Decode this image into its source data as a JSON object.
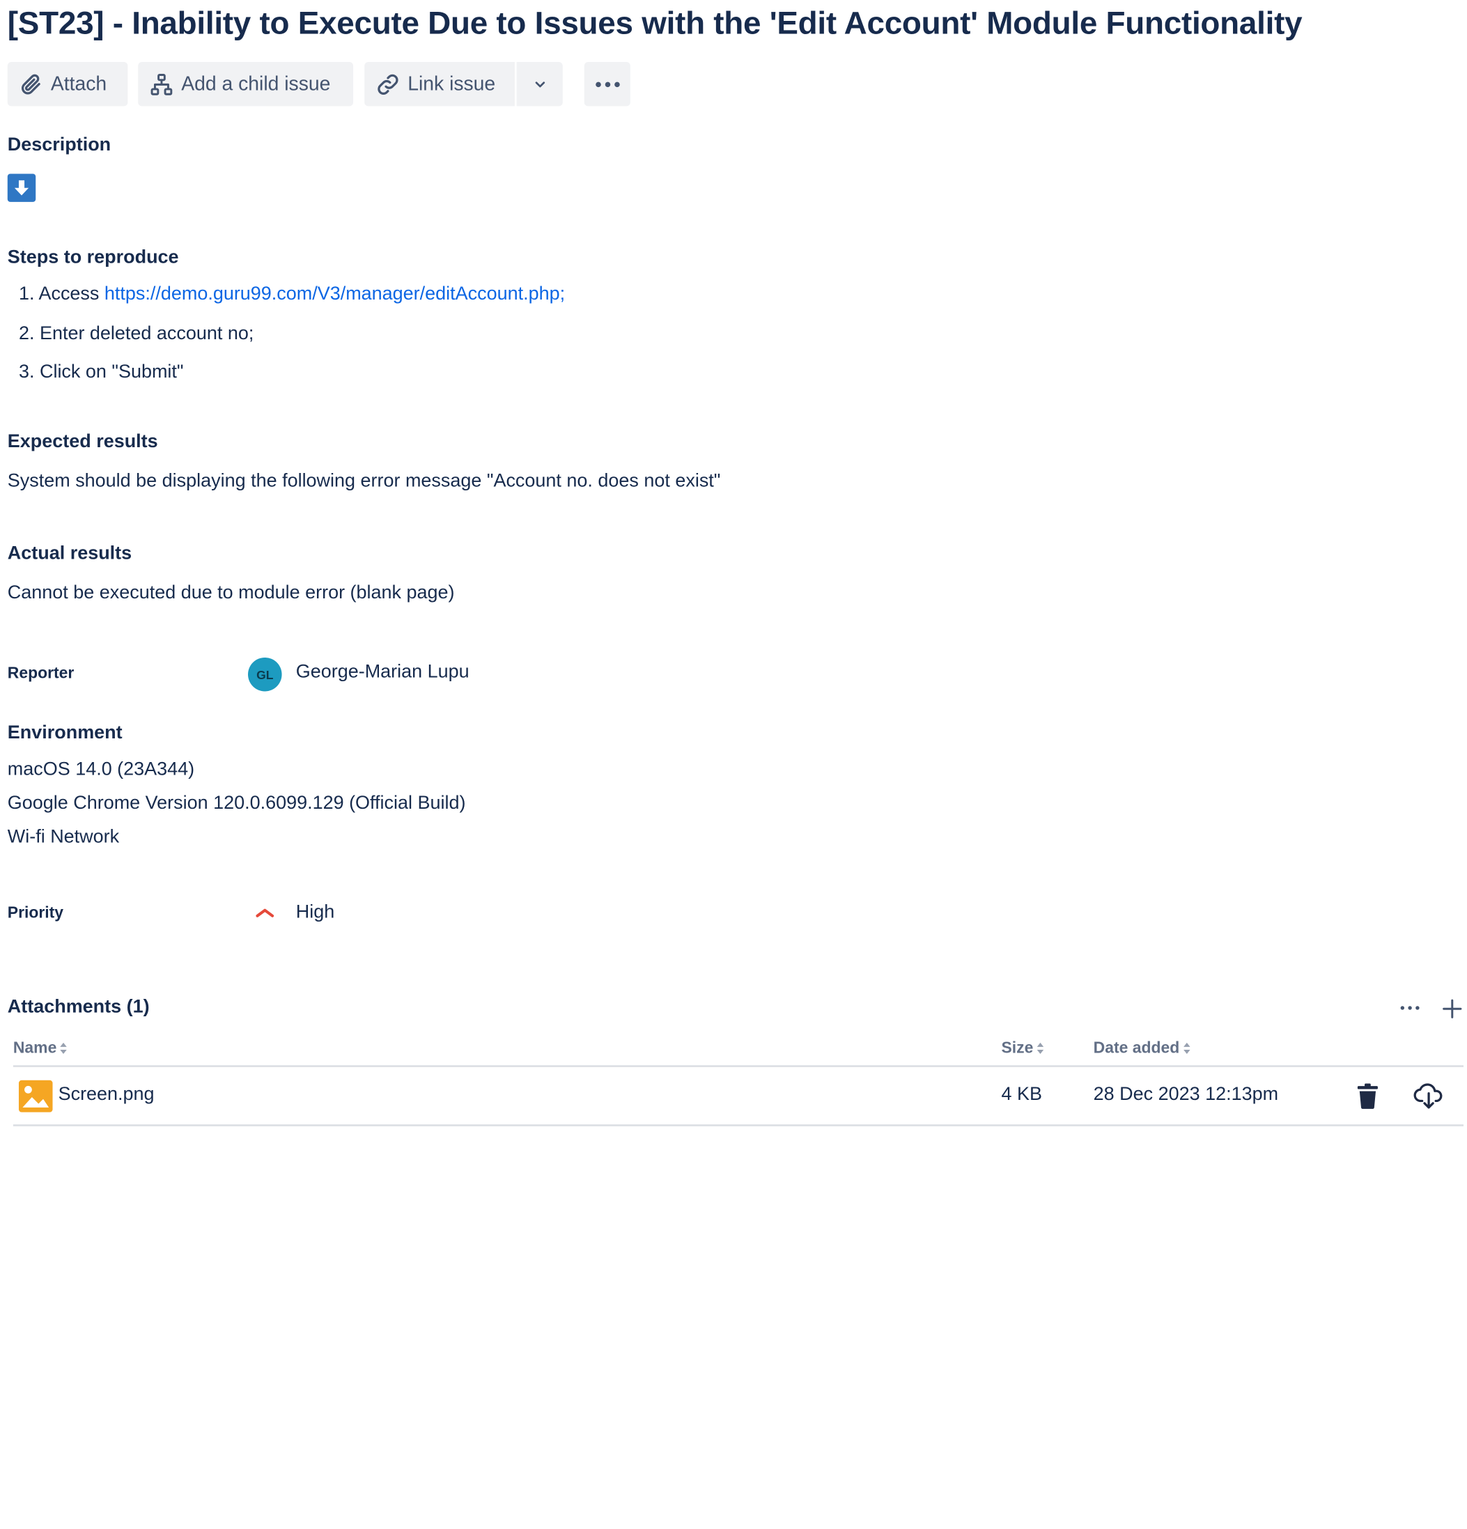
{
  "issue": {
    "title": "[ST23] - Inability to Execute Due to Issues with the 'Edit Account' Module Functionality"
  },
  "toolbar": {
    "attach_label": "Attach",
    "add_child_label": "Add a child issue",
    "link_issue_label": "Link issue"
  },
  "description": {
    "heading": "Description"
  },
  "steps": {
    "heading": "Steps to reproduce",
    "items": [
      {
        "number": "1.",
        "prefix": "Access ",
        "link": "https://demo.guru99.com/V3/manager/editAccount.php;"
      },
      {
        "number": "2.",
        "text": "Enter deleted account no;"
      },
      {
        "number": "3.",
        "text": "Click on \"Submit\""
      }
    ]
  },
  "expected": {
    "heading": "Expected results",
    "text": "System should be displaying the following error message \"Account no. does not exist\""
  },
  "actual": {
    "heading": "Actual results",
    "text": "Cannot be executed due to module error (blank page)"
  },
  "reporter": {
    "label": "Reporter",
    "initials": "GL",
    "name": "George-Marian Lupu"
  },
  "environment": {
    "heading": "Environment",
    "lines": [
      "macOS 14.0 (23A344)",
      "Google Chrome Version 120.0.6099.129 (Official Build)",
      "Wi-fi Network"
    ]
  },
  "priority": {
    "label": "Priority",
    "value": "High",
    "color": "#e5493a"
  },
  "attachments": {
    "heading": "Attachments (1)",
    "columns": {
      "name": "Name",
      "size": "Size",
      "date": "Date added"
    },
    "rows": [
      {
        "name": "Screen.png",
        "size": "4 KB",
        "date": "28 Dec 2023 12:13pm"
      }
    ]
  },
  "colors": {
    "title": "#172b4d",
    "link": "#0c66e4",
    "button_bg": "#f1f2f4",
    "avatar_bg": "#1d9bc0",
    "image_icon": "#f5a623",
    "download_icon_bg": "#2f77c4"
  },
  "icons": {
    "attach": "paperclip-icon",
    "add_child": "hierarchy-icon",
    "link_issue": "link-icon",
    "split": "chevron-down-icon",
    "more": "more-horizontal-icon",
    "description": "download-arrow-icon",
    "priority": "priority-high-chevron-icon",
    "attachments_more": "more-horizontal-icon",
    "attachments_add": "plus-icon",
    "file": "image-file-icon",
    "delete": "trash-icon",
    "download": "cloud-download-icon"
  }
}
